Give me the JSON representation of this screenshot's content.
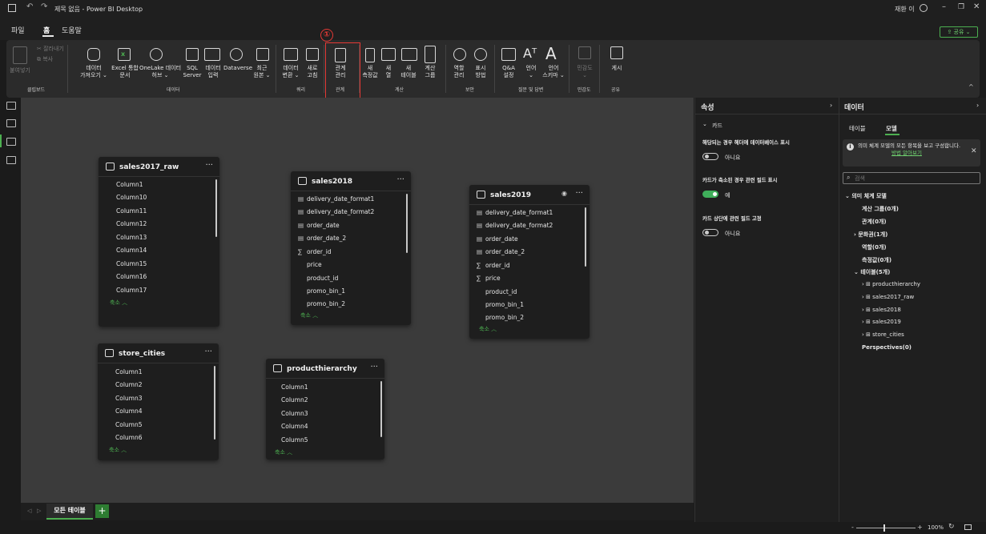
{
  "window": {
    "title": "제목 없음 - Power BI Desktop",
    "user": "재환 이"
  },
  "menu": {
    "items": [
      "파일",
      "홈",
      "도움말"
    ],
    "active": "홈",
    "share": "공유"
  },
  "ribbon": {
    "clipboard": {
      "paste": "붙여넣기",
      "cut": "잘라내기",
      "copy": "복사",
      "group": "클립보드"
    },
    "data": {
      "items": [
        "데이터\n가져오기 ⌄",
        "Excel 통합\n문서",
        "OneLake 데이터\n허브 ⌄",
        "SQL\nServer",
        "데이터\n입력",
        "Dataverse",
        "최근\n원본 ⌄"
      ],
      "group": "데이터"
    },
    "query": {
      "items": [
        "데이터\n변환 ⌄",
        "새로\n고침"
      ],
      "group": "쿼리"
    },
    "relationship": {
      "items": [
        "관계\n관리"
      ],
      "group": "관계"
    },
    "calc": {
      "items": [
        "새\n측정값",
        "새\n열",
        "새\n테이블",
        "계산\n그룹"
      ],
      "group": "계산"
    },
    "security": {
      "items": [
        "역할\n관리",
        "표시\n방법"
      ],
      "group": "보안"
    },
    "qa": {
      "items": [
        "Q&A\n설정",
        "언어\n⌄",
        "언어\n스키마 ⌄"
      ],
      "group": "질문 및 답변"
    },
    "sensitivity": {
      "items": [
        "민감도\n⌄"
      ],
      "group": "민감도"
    },
    "share": {
      "items": [
        "게시"
      ],
      "group": "공유"
    }
  },
  "annotation": {
    "number": "①"
  },
  "tables": [
    {
      "name": "sales2017_raw",
      "fields": [
        "Column1",
        "Column10",
        "Column11",
        "Column12",
        "Column13",
        "Column14",
        "Column15",
        "Column16",
        "Column17"
      ],
      "icons": [
        "",
        "",
        "",
        "",
        "",
        "",
        "",
        "",
        ""
      ]
    },
    {
      "name": "sales2018",
      "fields": [
        "delivery_date_format1",
        "delivery_date_format2",
        "order_date",
        "order_date_2",
        "order_id",
        "price",
        "product_id",
        "promo_bin_1",
        "promo_bin_2"
      ],
      "icons": [
        "▤",
        "▤",
        "▤",
        "▤",
        "∑",
        "",
        "",
        "",
        ""
      ]
    },
    {
      "name": "sales2019",
      "fields": [
        "delivery_date_format1",
        "delivery_date_format2",
        "order_date",
        "order_date_2",
        "order_id",
        "price",
        "product_id",
        "promo_bin_1",
        "promo_bin_2"
      ],
      "icons": [
        "▤",
        "▤",
        "▤",
        "▤",
        "∑",
        "∑",
        "",
        "",
        ""
      ]
    },
    {
      "name": "store_cities",
      "fields": [
        "Column1",
        "Column2",
        "Column3",
        "Column4",
        "Column5",
        "Column6"
      ],
      "icons": [
        "",
        "",
        "",
        "",
        "",
        ""
      ]
    },
    {
      "name": "producthierarchy",
      "fields": [
        "Column1",
        "Column2",
        "Column3",
        "Column4",
        "Column5"
      ],
      "icons": [
        "",
        "",
        "",
        "",
        ""
      ]
    }
  ],
  "collapse_label": "축소 ︿",
  "tabs": {
    "all_tables": "모든 테이블",
    "add": "+"
  },
  "properties": {
    "title": "속성",
    "section": "카드",
    "opt1_label": "해당되는 경우 헤더에 데이터베이스 표시",
    "opt1_value": "아니요",
    "opt2_label": "카드가 축소된 경우 관련 필드 표시",
    "opt2_value": "예",
    "opt3_label": "카드 상단에 관련 필드 고정",
    "opt3_value": "아니요"
  },
  "data_pane": {
    "title": "데이터",
    "tab_table": "테이블",
    "tab_model": "모델",
    "info": "의미 체계 모델의 모든 항목을 보고 구성합니다.",
    "info_link": "방법 알아보기",
    "search_placeholder": "검색",
    "tree": {
      "root": "의미 체계 모델",
      "calc_groups": "계산 그룹(0개)",
      "relationships": "관계(0개)",
      "cultures": "문화권(1개)",
      "roles": "역할(0개)",
      "measures": "측정값(0개)",
      "tables": "테이블(5개)",
      "table_items": [
        "producthierarchy",
        "sales2017_raw",
        "sales2018",
        "sales2019",
        "store_cities"
      ],
      "perspectives": "Perspectives(0)"
    }
  },
  "status": {
    "zoom": "100%"
  }
}
